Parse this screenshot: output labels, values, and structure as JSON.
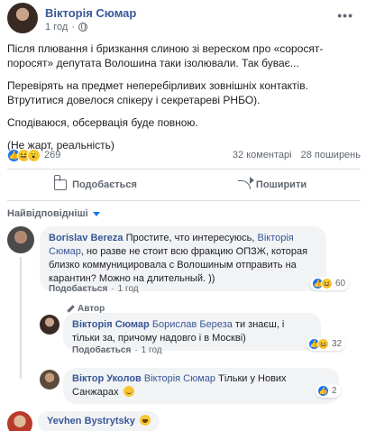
{
  "post": {
    "author": "Вікторія Сюмар",
    "time": "1 год",
    "paragraphs": [
      "Після плювання і бризкання слиною зі вереском про «соросят-поросят» депутата Волошина таки ізолювали. Так буває...",
      "Перевірять на предмет неперебірливих зовнішніх контактів. Втрутитися довелося спікеру і секретареві РНБО).",
      "Сподіваюся, обсервація буде повною.",
      "(Не жарт, реальність)"
    ],
    "reaction_count": "269",
    "comments_count": "32 коментарі",
    "shares_count": "28 поширень"
  },
  "actions": {
    "like": "Подобається",
    "share": "Поширити"
  },
  "sort_label": "Найвідповідніші",
  "comments": [
    {
      "author": "Borislav Bereza",
      "mention": "Вікторія Сюмар",
      "text_before": "Простите, что интересуюсь,",
      "text_after": ", но разве не стоит всю фракцию ОПЗЖ, которая близко коммуницировала с Волошиным отправить на карантин? Можно на длительный. ))",
      "like": "Подобається",
      "time": "1 год",
      "reactions": "60"
    },
    {
      "author_tag": "Автор",
      "author": "Вікторія Сюмар",
      "mention": "Борислав Береза",
      "text": "ти знаєш, і тільки за, причому надовго і в Москві)",
      "like": "Подобається",
      "time": "1 год",
      "reactions": "32"
    },
    {
      "author": "Віктор Уколов",
      "mention": "Вікторія Сюмар",
      "text": "Тільки у Нових Санжарах",
      "reactions": "2"
    },
    {
      "author": "Yevhen Bystrytsky"
    }
  ]
}
